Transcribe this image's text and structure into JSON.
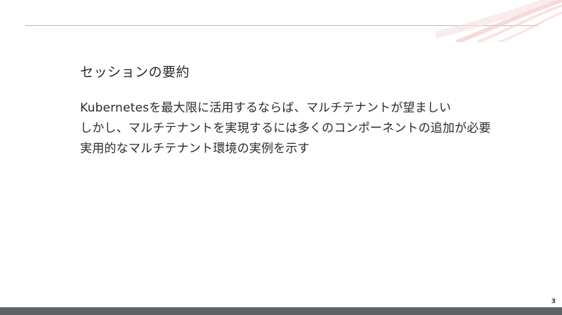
{
  "slide": {
    "title": "セッションの要約",
    "bullets": [
      "Kubernetesを最大限に活用するならば、マルチテナントが望ましい",
      "しかし、マルチテナントを実現するには多くのコンポーネントの追加が必要",
      "実用的なマルチテナント環境の実例を示す"
    ],
    "page_number": "3"
  },
  "colors": {
    "accent_line": "#e6a6a6",
    "footer_bar": "#5e6266",
    "text": "#2b2b2b"
  }
}
